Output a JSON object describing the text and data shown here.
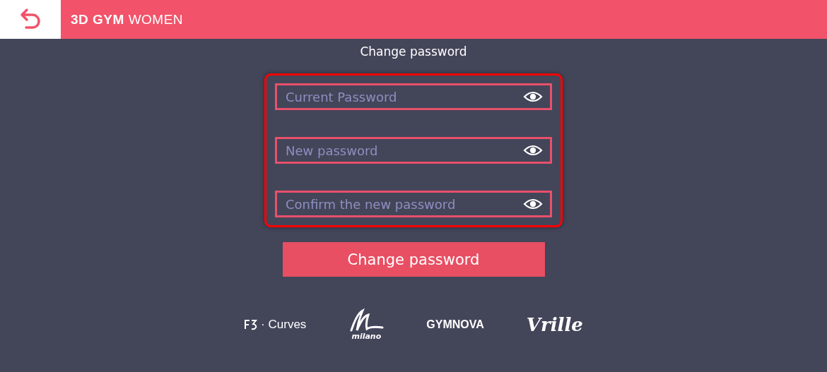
{
  "header": {
    "brand_bold": "3D GYM",
    "brand_light": "WOMEN"
  },
  "title": "Change password",
  "fields": [
    {
      "placeholder": "Current Password"
    },
    {
      "placeholder": "New password"
    },
    {
      "placeholder": "Confirm the new password"
    }
  ],
  "button": "Change password",
  "logos": [
    {
      "kind": "curves",
      "text": "· Curves"
    },
    {
      "kind": "milano",
      "text": "milano"
    },
    {
      "kind": "gymnova",
      "text": "GYMNOVA"
    },
    {
      "kind": "vrille",
      "text": "Vrille"
    }
  ]
}
